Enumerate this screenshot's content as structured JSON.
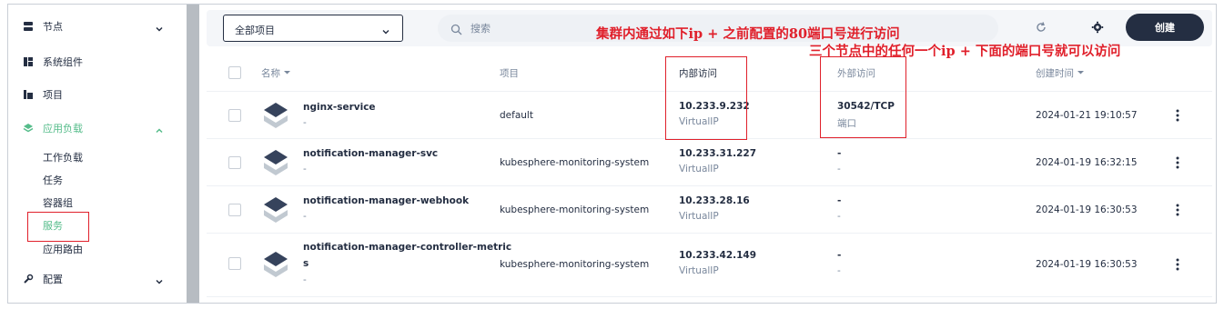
{
  "sidebar": {
    "groups": [
      {
        "label": "节点",
        "icon": "server-icon"
      },
      {
        "label": "系统组件",
        "icon": "components-icon"
      },
      {
        "label": "项目",
        "icon": "project-icon"
      },
      {
        "label": "应用负载",
        "icon": "workload-icon"
      },
      {
        "label": "配置",
        "icon": "config-icon"
      }
    ],
    "sub_items": [
      {
        "label": "工作负载"
      },
      {
        "label": "任务"
      },
      {
        "label": "容器组"
      },
      {
        "label": "服务"
      },
      {
        "label": "应用路由"
      }
    ]
  },
  "toolbar": {
    "project_select": "全部项目",
    "search_placeholder": "搜索",
    "create_label": "创建"
  },
  "annotations": {
    "internal_note": "集群内通过如下ip + 之前配置的80端口号进行访问",
    "external_note": "三个节点中的任何一个ip + 下面的端口号就可以访问"
  },
  "table": {
    "headers": {
      "name": "名称",
      "project": "项目",
      "internal": "内部访问",
      "external": "外部访问",
      "created": "创建时间"
    },
    "rows": [
      {
        "name": "nginx-service",
        "name_line2": "",
        "desc": "-",
        "project": "default",
        "internal_ip": "10.233.9.232",
        "internal_type": "VirtualIP",
        "external_main": "30542/TCP",
        "external_sub": "端口",
        "created": "2024-01-21 19:10:57"
      },
      {
        "name": "notification-manager-svc",
        "name_line2": "",
        "desc": "-",
        "project": "kubesphere-monitoring-system",
        "internal_ip": "10.233.31.227",
        "internal_type": "VirtualIP",
        "external_main": "-",
        "external_sub": "-",
        "created": "2024-01-19 16:32:15"
      },
      {
        "name": "notification-manager-webhook",
        "name_line2": "",
        "desc": "-",
        "project": "kubesphere-monitoring-system",
        "internal_ip": "10.233.28.16",
        "internal_type": "VirtualIP",
        "external_main": "-",
        "external_sub": "-",
        "created": "2024-01-19 16:30:53"
      },
      {
        "name": "notification-manager-controller-metric",
        "name_line2": "s",
        "desc": "-",
        "project": "kubesphere-monitoring-system",
        "internal_ip": "10.233.42.149",
        "internal_type": "VirtualIP",
        "external_main": "-",
        "external_sub": "-",
        "created": "2024-01-19 16:30:53"
      }
    ]
  },
  "colors": {
    "accent": "#55bc8a",
    "dark": "#242e42",
    "annotation": "#e0202b"
  }
}
